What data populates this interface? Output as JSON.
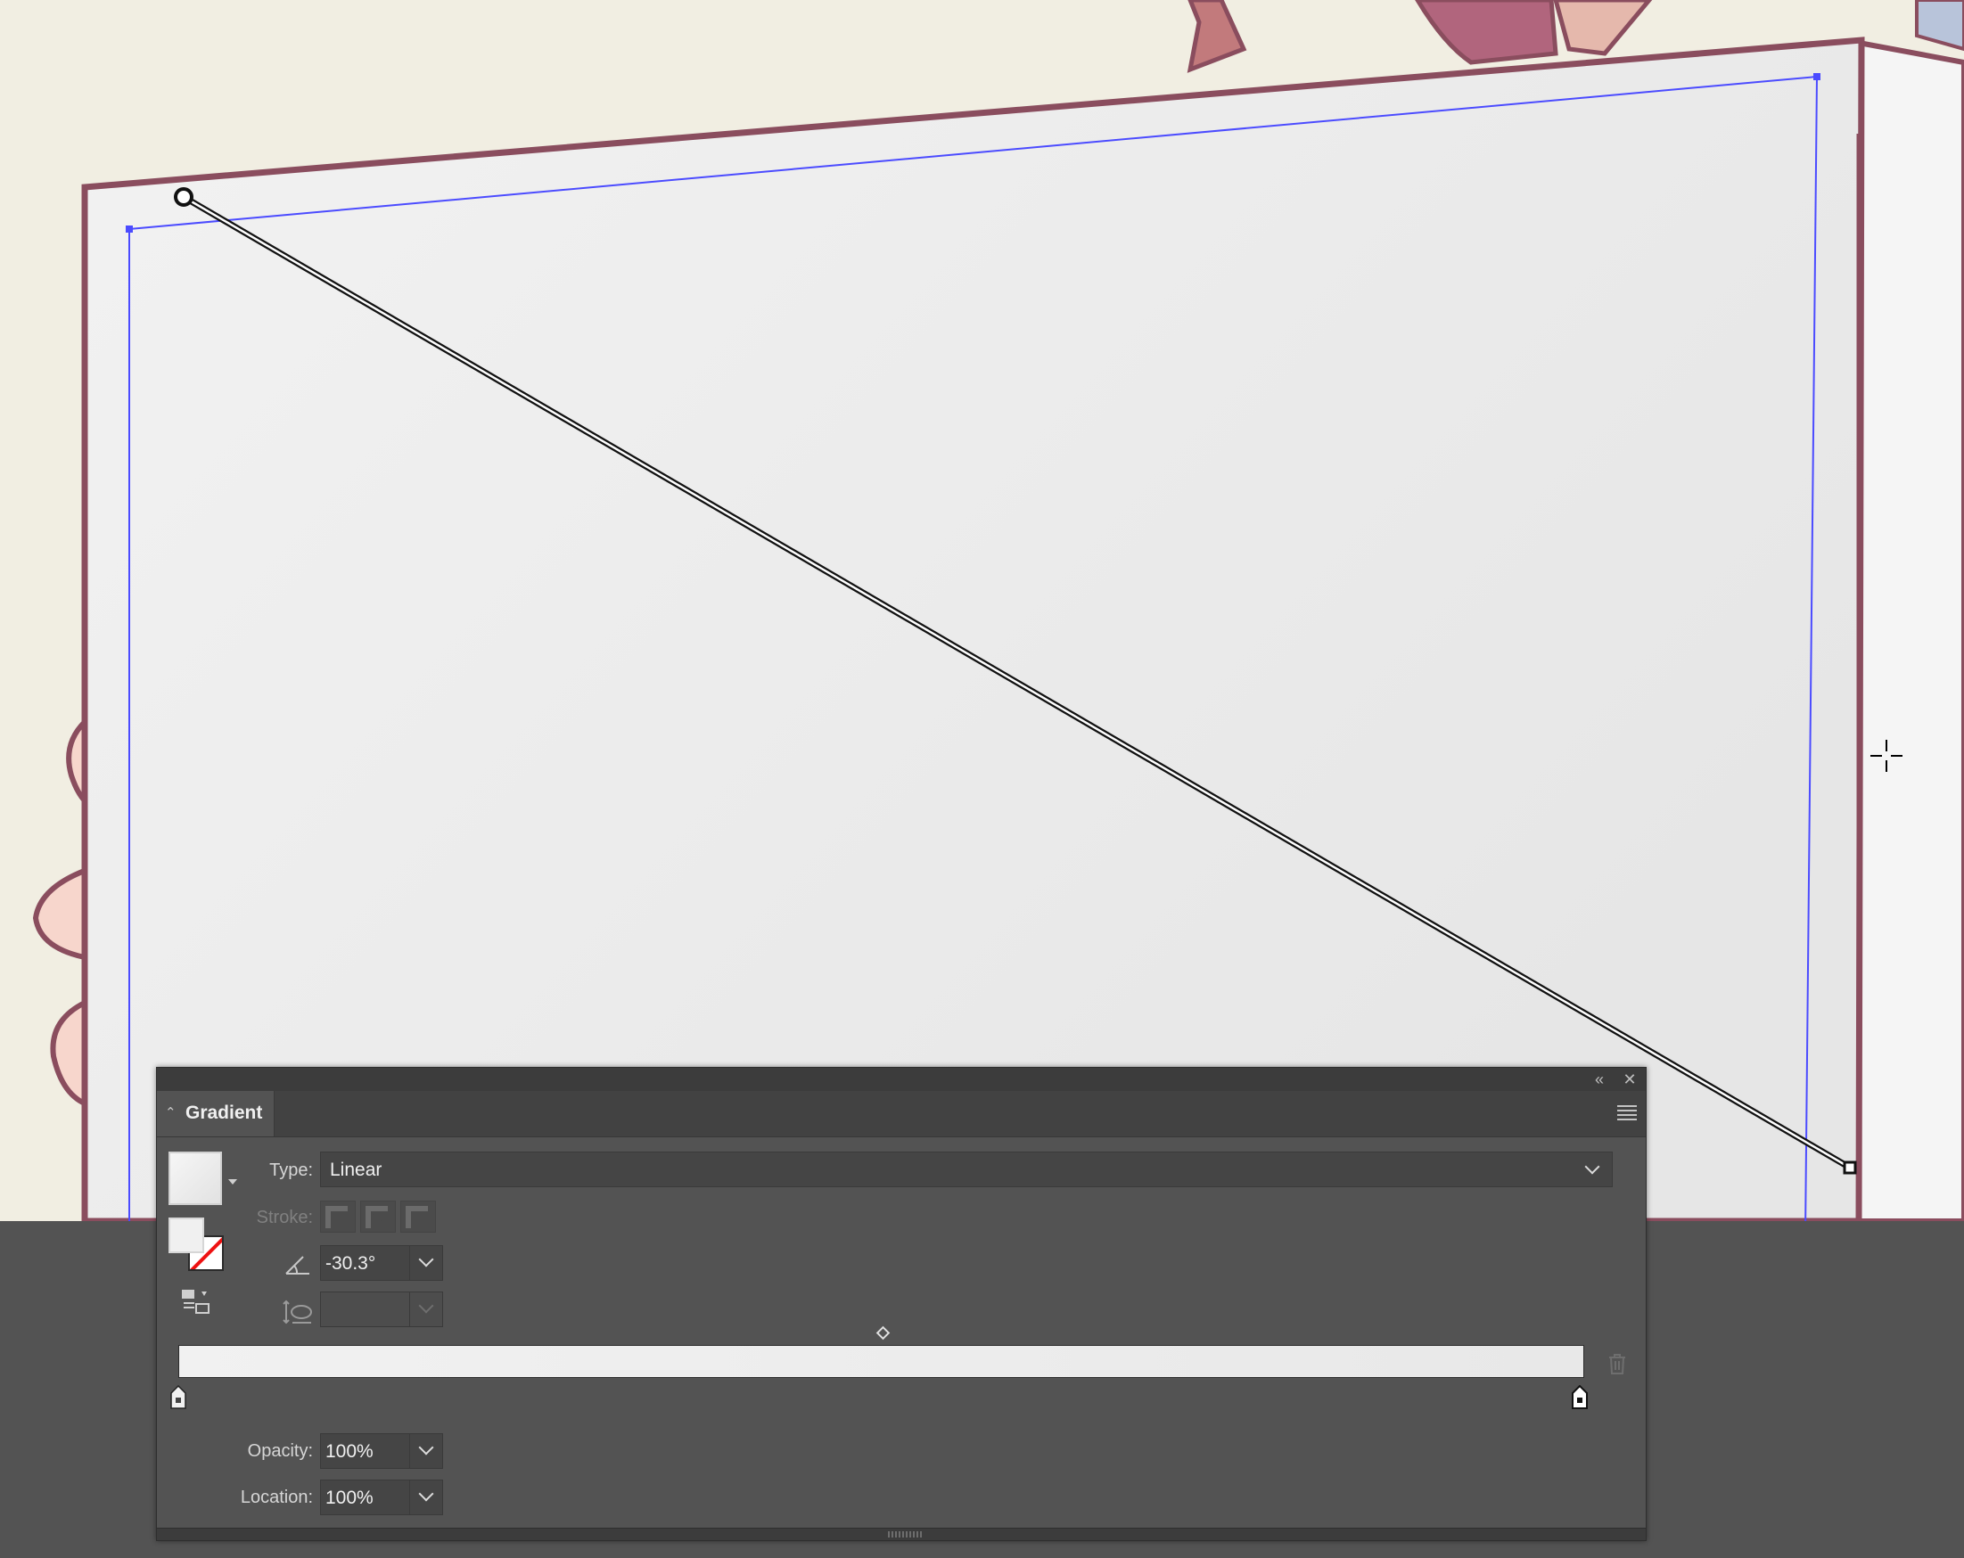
{
  "panel": {
    "title": "Gradient",
    "collapse_icon": "collapse-expand-icon",
    "titlebar": {
      "collapse_icon": "double-chevron-left-icon",
      "close_icon": "close-icon"
    },
    "menu_icon": "hamburger-menu-icon"
  },
  "type": {
    "label": "Type:",
    "value": "Linear"
  },
  "stroke": {
    "label": "Stroke:",
    "buttons": [
      "apply-gradient-within-stroke",
      "apply-gradient-along-stroke",
      "apply-gradient-across-stroke"
    ]
  },
  "angle": {
    "icon": "angle-icon",
    "value": "-30.3°"
  },
  "aspect_ratio": {
    "icon": "aspect-ratio-icon",
    "value": ""
  },
  "gradient": {
    "stops": [
      {
        "location_percent": 0,
        "color": "#f1f1f1",
        "selected": false
      },
      {
        "location_percent": 100,
        "color": "#e8e8e8",
        "selected": true
      }
    ],
    "midpoint_percent": 50
  },
  "opacity": {
    "label": "Opacity:",
    "value": "100%"
  },
  "location": {
    "label": "Location:",
    "value": "100%"
  },
  "colors": {
    "panel_bg": "#535353",
    "selection_blue": "#4b4bff",
    "outline_maroon": "#8a4d5e",
    "paper_cream": "#f1eee2"
  }
}
